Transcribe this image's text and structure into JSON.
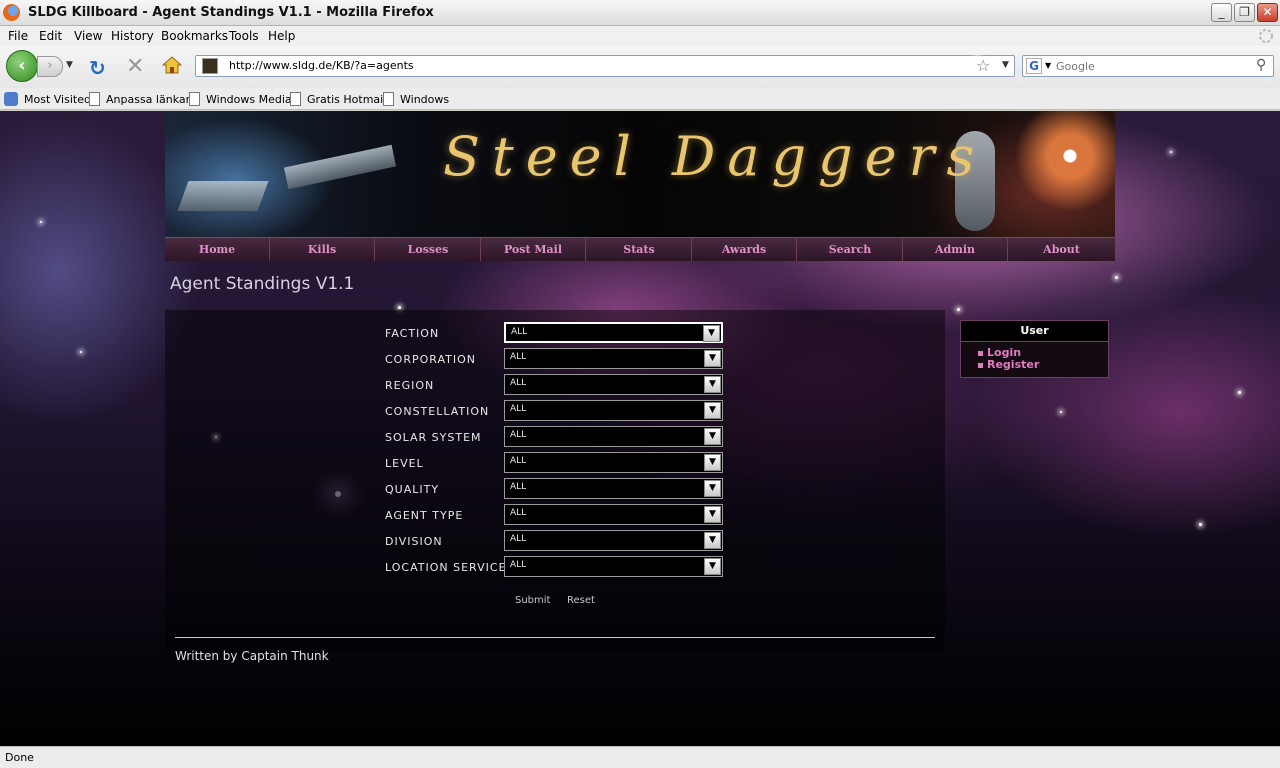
{
  "window": {
    "title": "SLDG Killboard - Agent Standings V1.1 - Mozilla Firefox",
    "min": "_",
    "max": "❐",
    "close": "✕"
  },
  "menu": [
    "File",
    "Edit",
    "View",
    "History",
    "Bookmarks",
    "Tools",
    "Help"
  ],
  "toolbar": {
    "url": "http://www.sldg.de/KB/?a=agents",
    "search_placeholder": "Google"
  },
  "bookmarks": [
    "Most Visited",
    "Anpassa länkar",
    "Windows Media",
    "Gratis Hotmail",
    "Windows"
  ],
  "site": {
    "logo": "Steel Daggers",
    "nav": [
      "Home",
      "Kills",
      "Losses",
      "Post Mail",
      "Stats",
      "Awards",
      "Search",
      "Admin",
      "About"
    ],
    "page_title": "Agent Standings V1.1",
    "filters": [
      {
        "label": "FACTION",
        "value": "ALL"
      },
      {
        "label": "CORPORATION",
        "value": "ALL"
      },
      {
        "label": "REGION",
        "value": "ALL"
      },
      {
        "label": "CONSTELLATION",
        "value": "ALL"
      },
      {
        "label": "SOLAR SYSTEM",
        "value": "ALL"
      },
      {
        "label": "LEVEL",
        "value": "ALL"
      },
      {
        "label": "QUALITY",
        "value": "ALL"
      },
      {
        "label": "AGENT TYPE",
        "value": "ALL"
      },
      {
        "label": "DIVISION",
        "value": "ALL"
      },
      {
        "label": "LOCATION SERVICE",
        "value": "ALL"
      }
    ],
    "submit": "Submit",
    "reset": "Reset",
    "footer": "Written by Captain Thunk",
    "userbox": {
      "title": "User",
      "links": [
        "Login",
        "Register"
      ]
    }
  },
  "status": "Done",
  "colors": {
    "nav_text": "#e090c8",
    "logo_gold": "#e9c66e",
    "link_pink": "#e07cc0"
  }
}
